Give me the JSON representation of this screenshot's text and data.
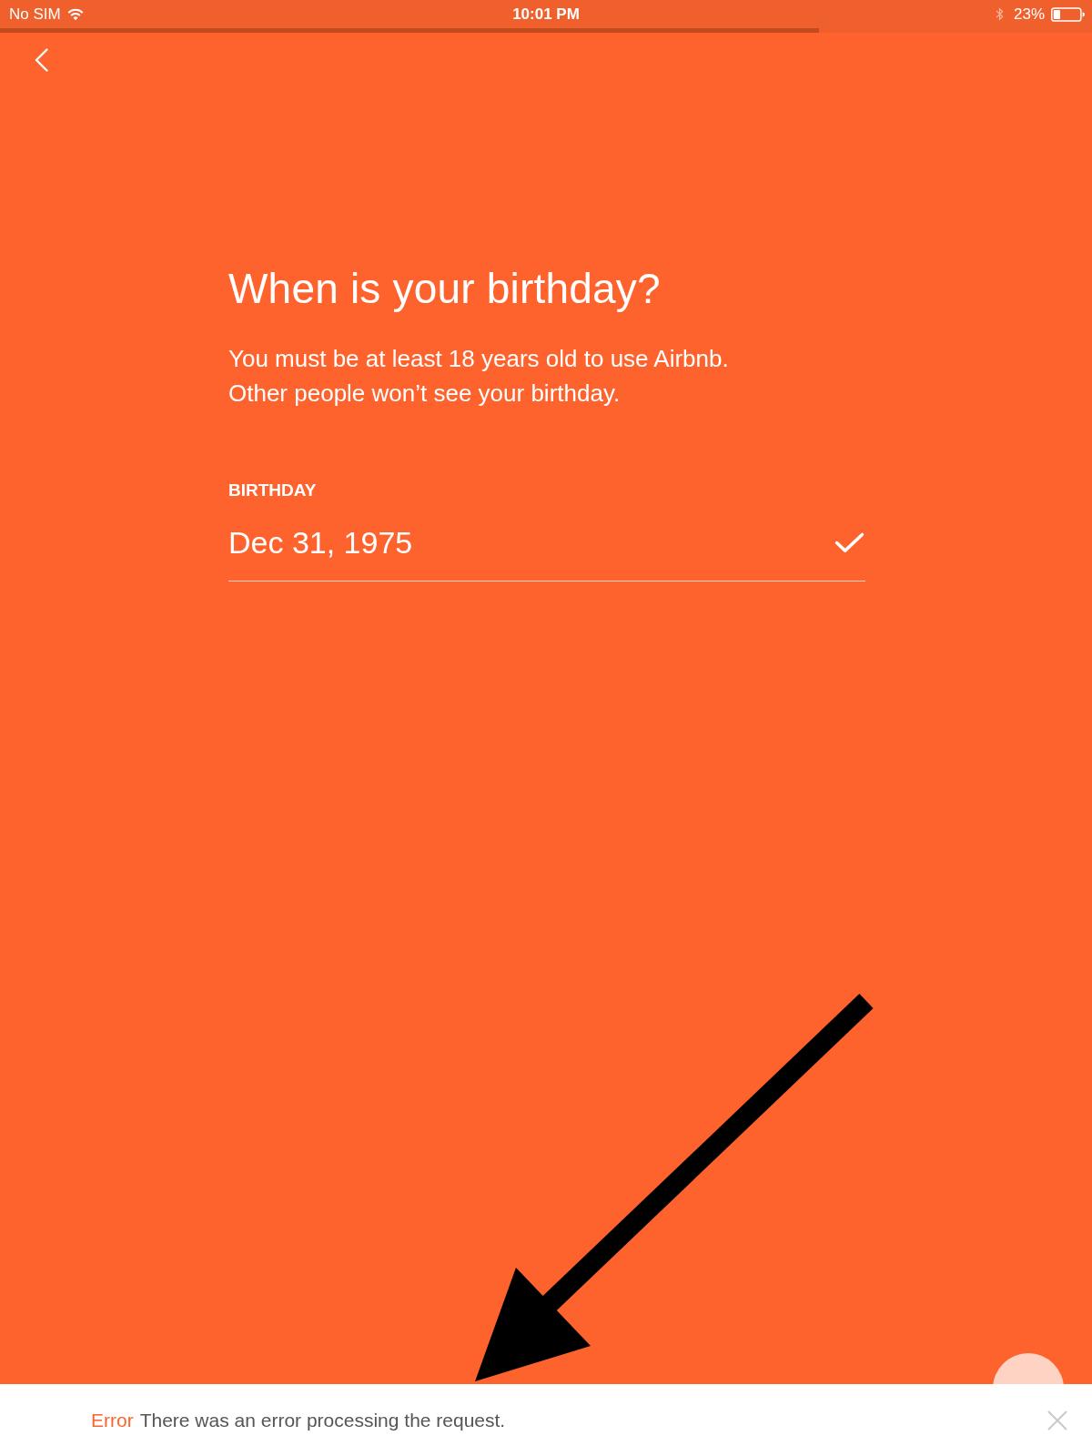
{
  "status_bar": {
    "carrier": "No SIM",
    "time": "10:01 PM",
    "battery": "23%"
  },
  "progress": {
    "level": 0.75
  },
  "title": "When is your birthday?",
  "subtitle": [
    "You must be at least 18 years old to use Airbnb.",
    "Other people won’t see your birthday."
  ],
  "field": {
    "label": "BIRTHDAY",
    "value": "Dec 31, 1975",
    "valid": true
  },
  "error_banner": {
    "title": "Error",
    "message": "There was an error processing the request."
  }
}
